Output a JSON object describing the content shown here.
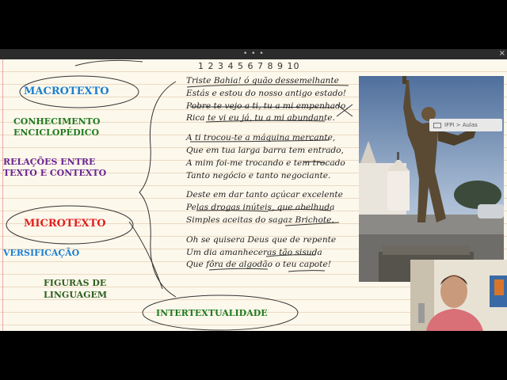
{
  "window": {
    "menu_dots": "• • •",
    "close_glyph": "×"
  },
  "overlay": {
    "breadcrumb": "IFPI > Aulas"
  },
  "notes": {
    "macrotexto": "MACROTEXTO",
    "conhecimento_1": "CONHECIMENTO",
    "conhecimento_2": "ENCICLOPÉDICO",
    "relacoes_1": "RELAÇÕES ENTRE",
    "relacoes_2": "TEXTO E CONTEXTO",
    "microtexto": "MICROTEXTO",
    "versificacao": "VERSIFICAÇÃO",
    "figuras_1": "FIGURAS DE",
    "figuras_2": "LINGUAGEM",
    "intertextualidade": "INTERTEXTUALIDADE",
    "syllable_numbers": "1 2 3 4 5 6 7 8 9 10"
  },
  "poem": {
    "stanzas": [
      [
        "Triste Bahia! ó quão dessemelhante",
        "Estás e estou do nosso antigo estado!",
        "Pobre te vejo a ti, tu a mi empenhado,",
        "Rica te vi eu já, tu a mi abundante."
      ],
      [
        "A ti trocou-te a máquina mercante,",
        "Que em tua larga barra tem entrado,",
        "A mim foi-me trocando e tem trocado",
        "Tanto negócio e tanto negociante."
      ],
      [
        "Deste em dar tanto açúcar excelente",
        "Pelas drogas inúteis, que abelhuda",
        "Simples aceitas do sagaz Brichote."
      ],
      [
        "Oh se quisera Deus que de repente",
        "Um dia amanheceras tão sisuda",
        "Que fôra de algodão o teu capote!"
      ]
    ]
  },
  "colors": {
    "blue": "#1a7fd0",
    "green": "#1f7a1f",
    "purple": "#6a2591",
    "red": "#e22020",
    "paper": "#fdf8ec"
  }
}
